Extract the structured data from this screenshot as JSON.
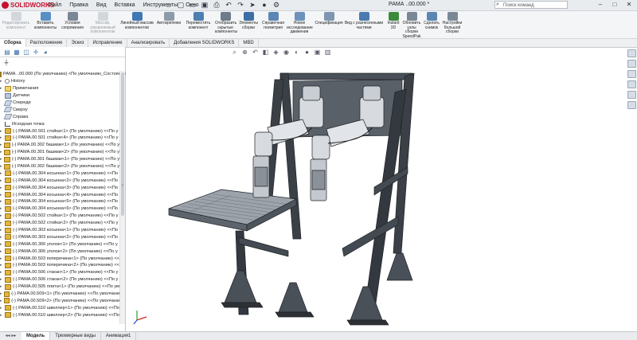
{
  "app": {
    "brand": "SOLIDWORKS",
    "menus": [
      "Файл",
      "Правка",
      "Вид",
      "Вставка",
      "Инструменты",
      "Окно"
    ],
    "doc_title": "РАМА ..00.000 *",
    "search_placeholder": "Поиск команд"
  },
  "quick_access": [
    "home-icon",
    "new-icon",
    "open-icon",
    "save-icon",
    "print-icon",
    "undo-icon",
    "redo-icon",
    "select-icon",
    "rebuild-icon",
    "options-icon"
  ],
  "toolbar": [
    {
      "label": "Редактировать компонент",
      "enabled": false,
      "color": "#a9b3bd"
    },
    {
      "label": "Вставить компоненты",
      "enabled": true,
      "color": "#5a8fc6"
    },
    {
      "label": "Условия сопряжения",
      "enabled": true,
      "color": "#7a8896"
    },
    {
      "label": "Массив, управляемый компонентом",
      "enabled": false,
      "color": "#a9b3bd"
    },
    {
      "label": "Линейный массив компонентов",
      "enabled": true,
      "color": "#3f78b4"
    },
    {
      "label": "Автокрепежи",
      "enabled": true,
      "color": "#8d9aa8"
    },
    {
      "label": "Переместить компонент",
      "enabled": true,
      "color": "#4e7fb1"
    },
    {
      "label": "Отобразить скрытые компоненты",
      "enabled": true,
      "color": "#6d7b8a"
    },
    {
      "label": "Элементы сборки",
      "enabled": true,
      "color": "#3b6fa5"
    },
    {
      "label": "Справочная геометрия",
      "enabled": true,
      "color": "#5b86b3"
    },
    {
      "label": "Новое исследование движения",
      "enabled": true,
      "color": "#6a92bd"
    },
    {
      "label": "Спецификация",
      "enabled": true,
      "color": "#7f96b0"
    },
    {
      "label": "Вид с разнесенными частями",
      "enabled": true,
      "color": "#4a7bb0"
    },
    {
      "label": "Instant 3D",
      "enabled": true,
      "color": "#3d8a3d"
    },
    {
      "label": "Обновить узлы сборки SpeedPak",
      "enabled": true,
      "color": "#7a8896"
    },
    {
      "label": "Сделать снимок",
      "enabled": true,
      "color": "#5b86b3"
    },
    {
      "label": "Настройки большой сборки",
      "enabled": true,
      "color": "#7a8896"
    }
  ],
  "command_tabs": [
    "Сборка",
    "Расположение",
    "Эскиз",
    "Исправление",
    "Анализировать",
    "Добавления SOLIDWORKS",
    "MBD"
  ],
  "tree": {
    "root": "РАМА ..00.000 (По умолчанию) <По умолчанию_Состояние",
    "items": [
      {
        "label": "History",
        "icon": "history-icon"
      },
      {
        "label": "Примечания",
        "icon": "annotations-icon"
      },
      {
        "label": "Датчики",
        "icon": "sensors-icon"
      },
      {
        "label": "Спереди",
        "icon": "plane-icon"
      },
      {
        "label": "Сверху",
        "icon": "plane-icon"
      },
      {
        "label": "Справа",
        "icon": "plane-icon"
      },
      {
        "label": "Исходная точка",
        "icon": "origin-icon"
      },
      {
        "label": "(-) РАМА.00.501  стойка<1> (По умолчанию) <<По у",
        "icon": "part-icon"
      },
      {
        "label": "(-) РАМА.00.501  стойка<4> (По умолчанию) <<По у",
        "icon": "part-icon"
      },
      {
        "label": "(-) РАМА.00.302  башмак<1> (По умолчанию) <<По у",
        "icon": "part-icon"
      },
      {
        "label": "(-) РАМА.00.301  башмак<2> (По умолчанию) <<По у",
        "icon": "part-icon"
      },
      {
        "label": "(-) РАМА.00.301  башмак<1> (По умолчанию) <<По у",
        "icon": "part-icon"
      },
      {
        "label": "(-) РАМА.00.302  башмак<2> (По умолчанию) <<По у",
        "icon": "part-icon"
      },
      {
        "label": "(-) РАМА.00.304  косынка<1> (По умолчанию) <<По",
        "icon": "part-icon"
      },
      {
        "label": "(-) РАМА.00.304  косынка<2> (По умолчанию) <<По",
        "icon": "part-icon"
      },
      {
        "label": "(-) РАМА.00.304  косынка<3> (По умолчанию) <<По",
        "icon": "part-icon"
      },
      {
        "label": "(-) РАМА.00.304  косынка<4> (По умолчанию) <<По",
        "icon": "part-icon"
      },
      {
        "label": "(-) РАМА.00.304  косынка<5> (По умолчанию) <<По",
        "icon": "part-icon"
      },
      {
        "label": "(-) РАМА.00.304  косынка<6> (По умолчанию) <<По",
        "icon": "part-icon"
      },
      {
        "label": "(-) РАМА.00.502  стойка<1> (По умолчанию) <<По у",
        "icon": "part-icon"
      },
      {
        "label": "(-) РАМА.00.502  стойка<2> (По умолчанию) <<По у",
        "icon": "part-icon"
      },
      {
        "label": "(-) РАМА.00.303  косынка<1> (По умолчанию) <<По",
        "icon": "part-icon"
      },
      {
        "label": "(-) РАМА.00.303  косынка<2> (По умолчанию) <<По",
        "icon": "part-icon"
      },
      {
        "label": "(-) РАМА.00.306  уголок<1> (По умолчанию) <<По у",
        "icon": "part-icon"
      },
      {
        "label": "(-) РАМА.00.306  уголок<2> (По умолчанию) <<По у",
        "icon": "part-icon"
      },
      {
        "label": "(-) РАМА.00.503  поперечина<1> (По умолчанию) <<",
        "icon": "part-icon"
      },
      {
        "label": "(-) РАМА.00.503  поперечина<2> (По умолчанию) <<",
        "icon": "part-icon"
      },
      {
        "label": "(-) РАМА.00.506  стакан<1> (По умолчанию) <<По у",
        "icon": "part-icon"
      },
      {
        "label": "(-) РАМА.00.506  стакан<2> (По умолчанию) <<По у",
        "icon": "part-icon"
      },
      {
        "label": "(-) РАМА.00.505 плита<1> (По умолчанию) <<По ум",
        "icon": "part-icon"
      },
      {
        "label": "(-) РАМА.00.509<1> (По умолчанию) <<По умолчани",
        "icon": "part-icon"
      },
      {
        "label": "(-) РАМА.00.509<2> (По умолчанию) <<По умолчани",
        "icon": "part-icon"
      },
      {
        "label": "(-) РАМА.00.510  швеллер<1> (По умолчанию) <<По",
        "icon": "part-icon"
      },
      {
        "label": "(-) РАМА.00.510  швеллер<2> (По умолчанию) <<По",
        "icon": "part-icon"
      }
    ]
  },
  "bottom_tabs": [
    "Модель",
    "Трехмерные виды",
    "Анимация1"
  ],
  "colors": {
    "frame": "#3b4047",
    "robot": "#d7dbe0",
    "accent": "#c8102e",
    "selection": "#3b6fa5"
  }
}
